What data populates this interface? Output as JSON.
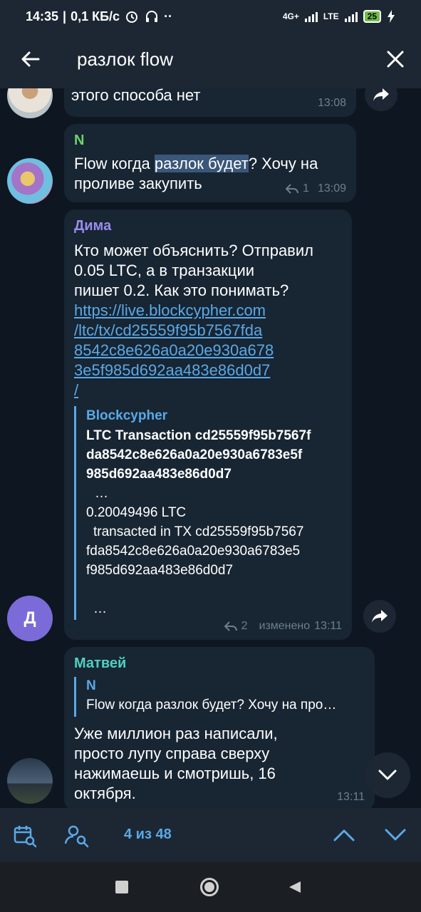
{
  "status_bar": {
    "time": "14:35",
    "speed": "0,1 КБ/с",
    "network1": "4G+",
    "network2": "LTE",
    "battery": "25"
  },
  "search": {
    "query": "разлок flow"
  },
  "messages": [
    {
      "text": "этого способа нет",
      "time": "13:08"
    },
    {
      "author": "N",
      "text_before": "Flow когда ",
      "text_highlight": "разлок будет",
      "text_after": "? Хочу на проливе закупить",
      "replies": "1",
      "time": "13:09"
    },
    {
      "author": "Дима",
      "text_line1": "Кто может объяснить? Отправил",
      "text_line2": "0.05 LTC, а в транзакции",
      "text_line3": "пишет 0.2. Как это понимать?",
      "link": "https://live.blockcypher.com/ltc/tx/cd25559f95b7567fda8542c8e626a0a20e930a6783e5f985d692aa483e86d0d7/",
      "link_lines": [
        "https://live.blockcypher.com",
        "/ltc/tx/cd25559f95b7567fda",
        "8542c8e626a0a20e930a678",
        "3e5f985d692aa483e86d0d7",
        "/"
      ],
      "preview_site": "Blockcypher",
      "preview_title_lines": [
        "LTC Transaction cd25559f95b7567f",
        "da8542c8e626a0a20e930a6783e5f",
        "985d692aa483e86d0d7"
      ],
      "preview_body_lines": [
        "…",
        "0.20049496 LTC",
        "transacted in TX cd25559f95b7567",
        "fda8542c8e626a0a20e930a6783e5",
        "f985d692aa483e86d0d7",
        "",
        "…"
      ],
      "avatar_letter": "Д",
      "replies": "2",
      "edited": "изменено",
      "time": "13:11"
    },
    {
      "author": "Матвей",
      "reply_author": "N",
      "reply_text": "Flow когда разлок будет? Хочу на про…",
      "text": "Уже миллион раз написали, просто лупу справа сверху нажимаешь и смотришь, 16 октября.",
      "time": "13:11"
    }
  ],
  "search_nav": {
    "counter": "4 из 48"
  },
  "colors": {
    "accent": "#5aa9e6",
    "bubble": "#182533",
    "background": "#0e1621",
    "header": "#1d2733",
    "name_green": "#6fd16f",
    "name_purple": "#9a8cf0",
    "name_teal": "#4fd0c2"
  }
}
